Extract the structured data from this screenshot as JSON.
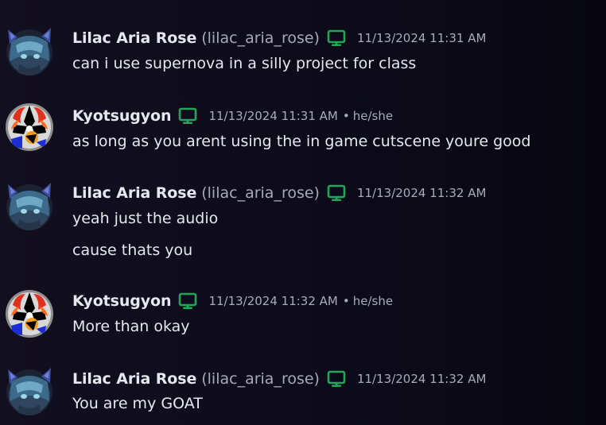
{
  "colors": {
    "device_icon": "#23a559",
    "name": "#e6e7ef",
    "muted": "#a9abbb"
  },
  "icons": {
    "device": "desktop-monitor-icon",
    "lilac_avatar": "cat-eared-character-avatar",
    "kyo_avatar": "flame-emblem-avatar"
  },
  "messages": [
    {
      "author": "Lilac Aria Rose",
      "handle": "(lilac_aria_rose)",
      "timestamp": "11/13/2024 11:31 AM",
      "lines": [
        "can i use supernova in a silly project for class"
      ]
    },
    {
      "author": "Kyotsugyon",
      "timestamp": "11/13/2024 11:31 AM",
      "separator": "•",
      "pronouns": "he/she",
      "lines": [
        "as long as you arent using the in game cutscene youre good"
      ]
    },
    {
      "author": "Lilac Aria Rose",
      "handle": "(lilac_aria_rose)",
      "timestamp": "11/13/2024 11:32 AM",
      "lines": [
        "yeah just the audio",
        "cause thats you"
      ]
    },
    {
      "author": "Kyotsugyon",
      "timestamp": "11/13/2024 11:32 AM",
      "separator": "•",
      "pronouns": "he/she",
      "lines": [
        "More than okay"
      ]
    },
    {
      "author": "Lilac Aria Rose",
      "handle": "(lilac_aria_rose)",
      "timestamp": "11/13/2024 11:32 AM",
      "lines": [
        "You are my GOAT"
      ]
    }
  ]
}
